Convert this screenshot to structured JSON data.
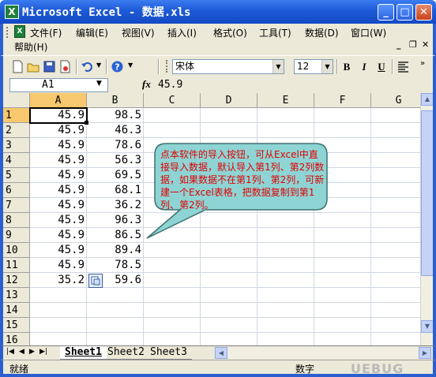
{
  "window": {
    "title": "Microsoft Excel - 数据.xls",
    "icon": "excel-icon"
  },
  "menu": {
    "items": [
      "文件(F)",
      "编辑(E)",
      "视图(V)",
      "插入(I)",
      "格式(O)",
      "工具(T)",
      "数据(D)",
      "窗口(W)",
      "帮助(H)"
    ]
  },
  "toolbar": {
    "font_name": "宋体",
    "font_size": "12",
    "bold": "B",
    "italic": "I",
    "underline": "U"
  },
  "formula_bar": {
    "name_box": "A1",
    "fx": "fx",
    "value": "45.9"
  },
  "grid": {
    "columns": [
      "A",
      "B",
      "C",
      "D",
      "E",
      "F",
      "G"
    ],
    "rows": [
      {
        "n": "1",
        "a": "45.9",
        "b": "98.5"
      },
      {
        "n": "2",
        "a": "45.9",
        "b": "46.3"
      },
      {
        "n": "3",
        "a": "45.9",
        "b": "78.6"
      },
      {
        "n": "4",
        "a": "45.9",
        "b": "56.3"
      },
      {
        "n": "5",
        "a": "45.9",
        "b": "69.5"
      },
      {
        "n": "6",
        "a": "45.9",
        "b": "68.1"
      },
      {
        "n": "7",
        "a": "45.9",
        "b": "36.2"
      },
      {
        "n": "8",
        "a": "45.9",
        "b": "96.3"
      },
      {
        "n": "9",
        "a": "45.9",
        "b": "86.5"
      },
      {
        "n": "10",
        "a": "45.9",
        "b": "89.4"
      },
      {
        "n": "11",
        "a": "45.9",
        "b": "78.5"
      },
      {
        "n": "12",
        "a": "35.2",
        "b": "59.6"
      },
      {
        "n": "13",
        "a": "",
        "b": ""
      },
      {
        "n": "14",
        "a": "",
        "b": ""
      },
      {
        "n": "15",
        "a": "",
        "b": ""
      },
      {
        "n": "16",
        "a": "",
        "b": ""
      }
    ]
  },
  "callout": {
    "text": "点本软件的导入按钮，可从Excel中直接导入数据，默认导入第1列、第2列数据，如果数据不在第1列、第2列，可新建一个Excel表格，把数据复制到第1列、第2列。",
    "fill": "#8fd4d4",
    "text_color": "#e00000"
  },
  "sheets": [
    "Sheet1",
    "Sheet2",
    "Sheet3"
  ],
  "status": {
    "left": "就绪",
    "num": "数字",
    "watermark": "UEBUG"
  },
  "colors": {
    "titlebar": "#1d5ad6",
    "selected_header": "#f7c86d",
    "chrome": "#ece9d8"
  }
}
